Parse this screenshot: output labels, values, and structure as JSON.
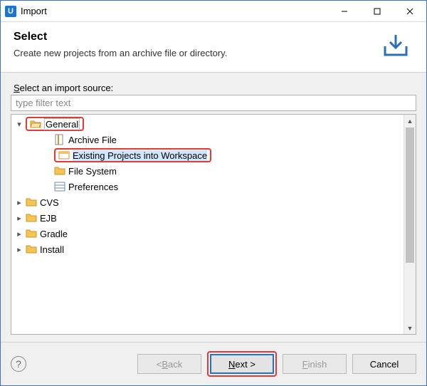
{
  "window": {
    "app_icon_letter": "U",
    "title": "Import"
  },
  "header": {
    "title": "Select",
    "description": "Create new projects from an archive file or directory."
  },
  "filter": {
    "label_pre": "S",
    "label_rest": "elect an import source:",
    "placeholder": "type filter text"
  },
  "tree": {
    "general": {
      "label": "General",
      "children": {
        "archive": "Archive File",
        "existing": "Existing Projects into Workspace",
        "filesystem": "File System",
        "preferences": "Preferences"
      }
    },
    "cvs": "CVS",
    "ejb": "EJB",
    "gradle": "Gradle",
    "install": "Install"
  },
  "buttons": {
    "back_pre": "< ",
    "back_ul": "B",
    "back_rest": "ack",
    "next_ul": "N",
    "next_rest": "ext >",
    "finish_ul": "F",
    "finish_rest": "inish",
    "cancel": "Cancel"
  },
  "icons": {
    "help": "?"
  }
}
